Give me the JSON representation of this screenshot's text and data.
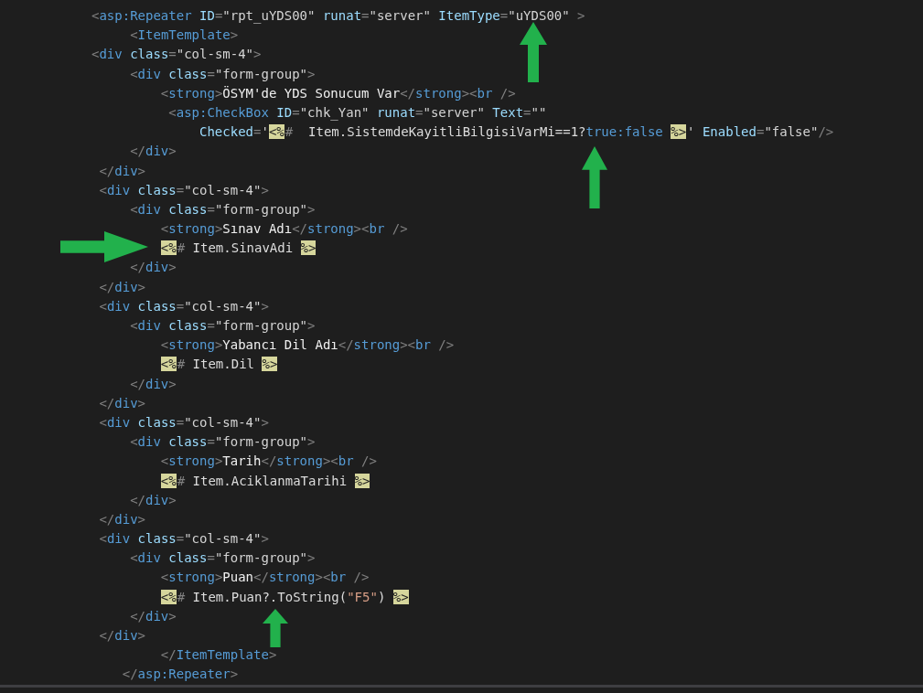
{
  "editor": {
    "lines": [
      {
        "tokens": [
          {
            "kind": "punct",
            "text": "<"
          },
          {
            "kind": "tag",
            "text": "asp:Repeater"
          },
          {
            "kind": "attr",
            "text": " ID"
          },
          {
            "kind": "punct",
            "text": "="
          },
          {
            "kind": "value",
            "text": "\"rpt_uYDS00\""
          },
          {
            "kind": "attr",
            "text": " runat"
          },
          {
            "kind": "punct",
            "text": "="
          },
          {
            "kind": "value",
            "text": "\"server\""
          },
          {
            "kind": "attr",
            "text": " ItemType"
          },
          {
            "kind": "punct",
            "text": "="
          },
          {
            "kind": "value",
            "text": "\"uYDS00\""
          },
          {
            "kind": "punct",
            "text": " >"
          }
        ]
      },
      {
        "tokens": [
          {
            "kind": "punct",
            "text": "     <"
          },
          {
            "kind": "tag",
            "text": "ItemTemplate"
          },
          {
            "kind": "punct",
            "text": ">"
          }
        ]
      },
      {
        "tokens": [
          {
            "kind": "punct",
            "text": "<"
          },
          {
            "kind": "tag",
            "text": "div"
          },
          {
            "kind": "attr",
            "text": " class"
          },
          {
            "kind": "punct",
            "text": "="
          },
          {
            "kind": "value",
            "text": "\"col-sm-4\""
          },
          {
            "kind": "punct",
            "text": ">"
          }
        ]
      },
      {
        "tokens": [
          {
            "kind": "punct",
            "text": "     <"
          },
          {
            "kind": "tag",
            "text": "div"
          },
          {
            "kind": "attr",
            "text": " class"
          },
          {
            "kind": "punct",
            "text": "="
          },
          {
            "kind": "value",
            "text": "\"form-group\""
          },
          {
            "kind": "punct",
            "text": ">"
          }
        ]
      },
      {
        "tokens": [
          {
            "kind": "punct",
            "text": "         <"
          },
          {
            "kind": "tag",
            "text": "strong"
          },
          {
            "kind": "punct",
            "text": ">"
          },
          {
            "kind": "text",
            "text": "ÖSYM'de YDS Sonucum Var"
          },
          {
            "kind": "punct",
            "text": "</"
          },
          {
            "kind": "tag",
            "text": "strong"
          },
          {
            "kind": "punct",
            "text": "><"
          },
          {
            "kind": "tag",
            "text": "br"
          },
          {
            "kind": "punct",
            "text": " />"
          }
        ]
      },
      {
        "tokens": [
          {
            "kind": "punct",
            "text": "          <"
          },
          {
            "kind": "tag",
            "text": "asp:CheckBox"
          },
          {
            "kind": "attr",
            "text": " ID"
          },
          {
            "kind": "punct",
            "text": "="
          },
          {
            "kind": "value",
            "text": "\"chk_Yan\""
          },
          {
            "kind": "attr",
            "text": " runat"
          },
          {
            "kind": "punct",
            "text": "="
          },
          {
            "kind": "value",
            "text": "\"server\""
          },
          {
            "kind": "attr",
            "text": " Text"
          },
          {
            "kind": "punct",
            "text": "="
          },
          {
            "kind": "value",
            "text": "\"\""
          }
        ]
      },
      {
        "tokens": [
          {
            "kind": "attr",
            "text": "              Checked"
          },
          {
            "kind": "punct",
            "text": "="
          },
          {
            "kind": "value",
            "text": "'"
          },
          {
            "kind": "delim",
            "text": "<%"
          },
          {
            "kind": "punct",
            "text": "#"
          },
          {
            "kind": "code",
            "text": "  Item.SistemdeKayitliBilgisiVarMi==1?"
          },
          {
            "kind": "keyword",
            "text": "true:false "
          },
          {
            "kind": "delim",
            "text": "%>"
          },
          {
            "kind": "value",
            "text": "'"
          },
          {
            "kind": "attr",
            "text": " Enabled"
          },
          {
            "kind": "punct",
            "text": "="
          },
          {
            "kind": "value",
            "text": "\"false\""
          },
          {
            "kind": "punct",
            "text": "/>"
          }
        ]
      },
      {
        "tokens": [
          {
            "kind": "punct",
            "text": "     </"
          },
          {
            "kind": "tag",
            "text": "div"
          },
          {
            "kind": "punct",
            "text": ">"
          }
        ]
      },
      {
        "tokens": [
          {
            "kind": "punct",
            "text": " </"
          },
          {
            "kind": "tag",
            "text": "div"
          },
          {
            "kind": "punct",
            "text": ">"
          }
        ]
      },
      {
        "tokens": [
          {
            "kind": "punct",
            "text": " <"
          },
          {
            "kind": "tag",
            "text": "div"
          },
          {
            "kind": "attr",
            "text": " class"
          },
          {
            "kind": "punct",
            "text": "="
          },
          {
            "kind": "value",
            "text": "\"col-sm-4\""
          },
          {
            "kind": "punct",
            "text": ">"
          }
        ]
      },
      {
        "tokens": [
          {
            "kind": "punct",
            "text": "     <"
          },
          {
            "kind": "tag",
            "text": "div"
          },
          {
            "kind": "attr",
            "text": " class"
          },
          {
            "kind": "punct",
            "text": "="
          },
          {
            "kind": "value",
            "text": "\"form-group\""
          },
          {
            "kind": "punct",
            "text": ">"
          }
        ]
      },
      {
        "tokens": [
          {
            "kind": "punct",
            "text": "         <"
          },
          {
            "kind": "tag",
            "text": "strong"
          },
          {
            "kind": "punct",
            "text": ">"
          },
          {
            "kind": "text",
            "text": "Sınav Adı"
          },
          {
            "kind": "punct",
            "text": "</"
          },
          {
            "kind": "tag",
            "text": "strong"
          },
          {
            "kind": "punct",
            "text": "><"
          },
          {
            "kind": "tag",
            "text": "br"
          },
          {
            "kind": "punct",
            "text": " />"
          }
        ]
      },
      {
        "tokens": [
          {
            "kind": "delim",
            "text": "         <%"
          },
          {
            "kind": "punct",
            "text": "#"
          },
          {
            "kind": "code",
            "text": " Item.SinavAdi "
          },
          {
            "kind": "delim",
            "text": "%>"
          }
        ]
      },
      {
        "tokens": [
          {
            "kind": "punct",
            "text": "     </"
          },
          {
            "kind": "tag",
            "text": "div"
          },
          {
            "kind": "punct",
            "text": ">"
          }
        ]
      },
      {
        "tokens": [
          {
            "kind": "punct",
            "text": " </"
          },
          {
            "kind": "tag",
            "text": "div"
          },
          {
            "kind": "punct",
            "text": ">"
          }
        ]
      },
      {
        "tokens": [
          {
            "kind": "punct",
            "text": " <"
          },
          {
            "kind": "tag",
            "text": "div"
          },
          {
            "kind": "attr",
            "text": " class"
          },
          {
            "kind": "punct",
            "text": "="
          },
          {
            "kind": "value",
            "text": "\"col-sm-4\""
          },
          {
            "kind": "punct",
            "text": ">"
          }
        ]
      },
      {
        "tokens": [
          {
            "kind": "punct",
            "text": "     <"
          },
          {
            "kind": "tag",
            "text": "div"
          },
          {
            "kind": "attr",
            "text": " class"
          },
          {
            "kind": "punct",
            "text": "="
          },
          {
            "kind": "value",
            "text": "\"form-group\""
          },
          {
            "kind": "punct",
            "text": ">"
          }
        ]
      },
      {
        "tokens": [
          {
            "kind": "punct",
            "text": "         <"
          },
          {
            "kind": "tag",
            "text": "strong"
          },
          {
            "kind": "punct",
            "text": ">"
          },
          {
            "kind": "text",
            "text": "Yabancı Dil Adı"
          },
          {
            "kind": "punct",
            "text": "</"
          },
          {
            "kind": "tag",
            "text": "strong"
          },
          {
            "kind": "punct",
            "text": "><"
          },
          {
            "kind": "tag",
            "text": "br"
          },
          {
            "kind": "punct",
            "text": " />"
          }
        ]
      },
      {
        "tokens": [
          {
            "kind": "delim",
            "text": "         <%"
          },
          {
            "kind": "punct",
            "text": "#"
          },
          {
            "kind": "code",
            "text": " Item.Dil "
          },
          {
            "kind": "delim",
            "text": "%>"
          }
        ]
      },
      {
        "tokens": [
          {
            "kind": "punct",
            "text": "     </"
          },
          {
            "kind": "tag",
            "text": "div"
          },
          {
            "kind": "punct",
            "text": ">"
          }
        ]
      },
      {
        "tokens": [
          {
            "kind": "punct",
            "text": " </"
          },
          {
            "kind": "tag",
            "text": "div"
          },
          {
            "kind": "punct",
            "text": ">"
          }
        ]
      },
      {
        "tokens": [
          {
            "kind": "punct",
            "text": " <"
          },
          {
            "kind": "tag",
            "text": "div"
          },
          {
            "kind": "attr",
            "text": " class"
          },
          {
            "kind": "punct",
            "text": "="
          },
          {
            "kind": "value",
            "text": "\"col-sm-4\""
          },
          {
            "kind": "punct",
            "text": ">"
          }
        ]
      },
      {
        "tokens": [
          {
            "kind": "punct",
            "text": "     <"
          },
          {
            "kind": "tag",
            "text": "div"
          },
          {
            "kind": "attr",
            "text": " class"
          },
          {
            "kind": "punct",
            "text": "="
          },
          {
            "kind": "value",
            "text": "\"form-group\""
          },
          {
            "kind": "punct",
            "text": ">"
          }
        ]
      },
      {
        "tokens": [
          {
            "kind": "punct",
            "text": "         <"
          },
          {
            "kind": "tag",
            "text": "strong"
          },
          {
            "kind": "punct",
            "text": ">"
          },
          {
            "kind": "text",
            "text": "Tarih"
          },
          {
            "kind": "punct",
            "text": "</"
          },
          {
            "kind": "tag",
            "text": "strong"
          },
          {
            "kind": "punct",
            "text": "><"
          },
          {
            "kind": "tag",
            "text": "br"
          },
          {
            "kind": "punct",
            "text": " />"
          }
        ]
      },
      {
        "tokens": [
          {
            "kind": "delim",
            "text": "         <%"
          },
          {
            "kind": "punct",
            "text": "#"
          },
          {
            "kind": "code",
            "text": " Item.AciklanmaTarihi "
          },
          {
            "kind": "delim",
            "text": "%>"
          }
        ]
      },
      {
        "tokens": [
          {
            "kind": "punct",
            "text": "     </"
          },
          {
            "kind": "tag",
            "text": "div"
          },
          {
            "kind": "punct",
            "text": ">"
          }
        ]
      },
      {
        "tokens": [
          {
            "kind": "punct",
            "text": " </"
          },
          {
            "kind": "tag",
            "text": "div"
          },
          {
            "kind": "punct",
            "text": ">"
          }
        ]
      },
      {
        "tokens": [
          {
            "kind": "punct",
            "text": " <"
          },
          {
            "kind": "tag",
            "text": "div"
          },
          {
            "kind": "attr",
            "text": " class"
          },
          {
            "kind": "punct",
            "text": "="
          },
          {
            "kind": "value",
            "text": "\"col-sm-4\""
          },
          {
            "kind": "punct",
            "text": ">"
          }
        ]
      },
      {
        "tokens": [
          {
            "kind": "punct",
            "text": "     <"
          },
          {
            "kind": "tag",
            "text": "div"
          },
          {
            "kind": "attr",
            "text": " class"
          },
          {
            "kind": "punct",
            "text": "="
          },
          {
            "kind": "value",
            "text": "\"form-group\""
          },
          {
            "kind": "punct",
            "text": ">"
          }
        ]
      },
      {
        "tokens": [
          {
            "kind": "punct",
            "text": "         <"
          },
          {
            "kind": "tag",
            "text": "strong"
          },
          {
            "kind": "punct",
            "text": ">"
          },
          {
            "kind": "text",
            "text": "Puan"
          },
          {
            "kind": "punct",
            "text": "</"
          },
          {
            "kind": "tag",
            "text": "strong"
          },
          {
            "kind": "punct",
            "text": "><"
          },
          {
            "kind": "tag",
            "text": "br"
          },
          {
            "kind": "punct",
            "text": " />"
          }
        ]
      },
      {
        "tokens": [
          {
            "kind": "delim",
            "text": "         <%"
          },
          {
            "kind": "punct",
            "text": "#"
          },
          {
            "kind": "code",
            "text": " Item.Puan?.ToString("
          },
          {
            "kind": "string",
            "text": "\"F5\""
          },
          {
            "kind": "code",
            "text": ") "
          },
          {
            "kind": "delim",
            "text": "%>"
          }
        ]
      },
      {
        "tokens": [
          {
            "kind": "punct",
            "text": "     </"
          },
          {
            "kind": "tag",
            "text": "div"
          },
          {
            "kind": "punct",
            "text": ">"
          }
        ]
      },
      {
        "tokens": [
          {
            "kind": "punct",
            "text": " </"
          },
          {
            "kind": "tag",
            "text": "div"
          },
          {
            "kind": "punct",
            "text": ">"
          }
        ]
      },
      {
        "tokens": [
          {
            "kind": "punct",
            "text": "         </"
          },
          {
            "kind": "tag",
            "text": "ItemTemplate"
          },
          {
            "kind": "punct",
            "text": ">"
          }
        ]
      },
      {
        "tokens": [
          {
            "kind": "punct",
            "text": "    </"
          },
          {
            "kind": "tag",
            "text": "asp:Repeater"
          },
          {
            "kind": "punct",
            "text": ">"
          }
        ]
      }
    ]
  }
}
